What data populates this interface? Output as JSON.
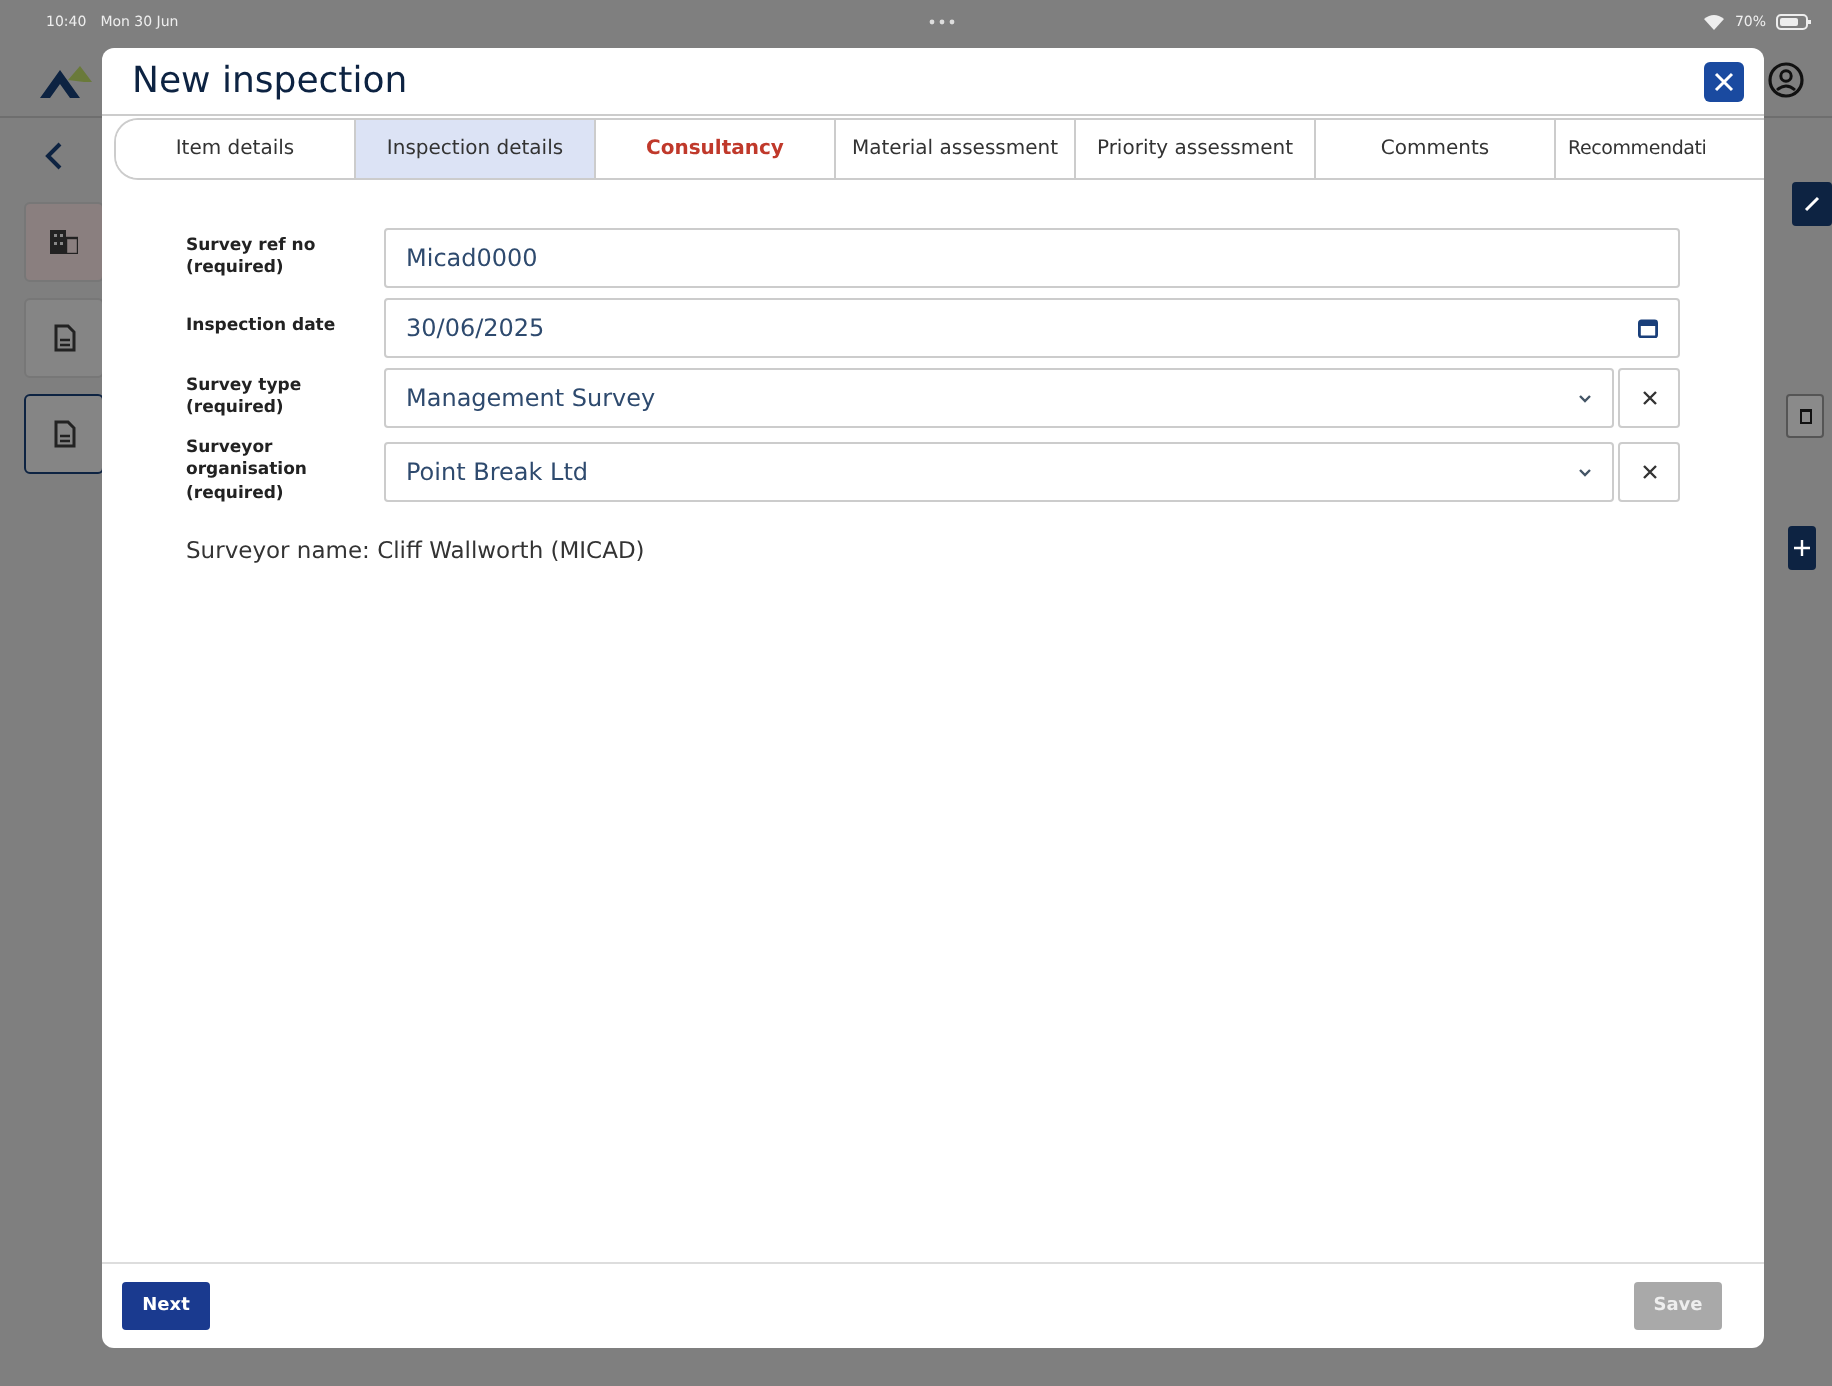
{
  "status_bar": {
    "time": "10:40",
    "date": "Mon 30 Jun",
    "battery": "70%"
  },
  "modal": {
    "title": "New inspection",
    "tabs": [
      {
        "label": "Item details",
        "selected": false,
        "error": false
      },
      {
        "label": "Inspection details",
        "selected": true,
        "error": false
      },
      {
        "label": "Consultancy",
        "selected": false,
        "error": true
      },
      {
        "label": "Material assessment",
        "selected": false,
        "error": false
      },
      {
        "label": "Priority assessment",
        "selected": false,
        "error": false
      },
      {
        "label": "Comments",
        "selected": false,
        "error": false
      },
      {
        "label": "Recommendati",
        "selected": false,
        "error": false
      }
    ],
    "fields": [
      {
        "kind": "text",
        "label": "Survey ref no (required)",
        "value": "Micad0000"
      },
      {
        "kind": "date",
        "label": "Inspection date",
        "value": "30/06/2025"
      },
      {
        "kind": "select",
        "label": "Survey type (required)",
        "value": "Management Survey"
      },
      {
        "kind": "select",
        "label": "Surveyor organisation (required)",
        "value": "Point Break Ltd"
      }
    ],
    "surveyor_name": "Surveyor name: Cliff Wallworth (MICAD)",
    "buttons": [
      {
        "label": "Next",
        "disabled": false
      },
      {
        "label": "Save",
        "disabled": true
      }
    ]
  }
}
